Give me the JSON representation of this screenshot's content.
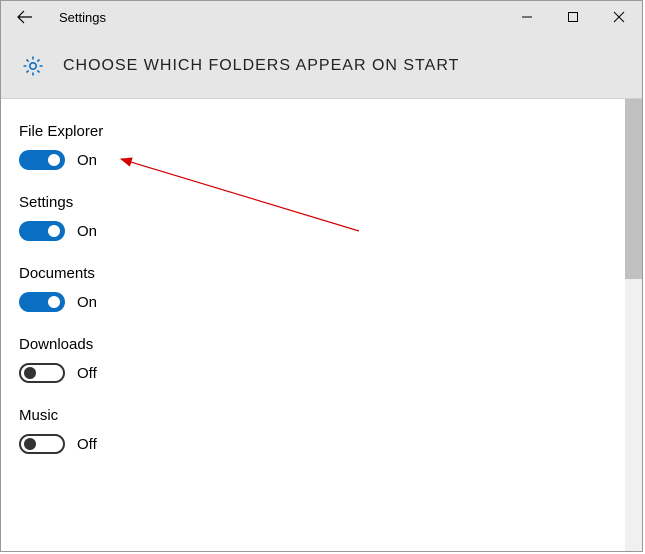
{
  "titlebar": {
    "title": "Settings"
  },
  "header": {
    "page_title": "CHOOSE WHICH FOLDERS APPEAR ON START"
  },
  "state_labels": {
    "on": "On",
    "off": "Off"
  },
  "settings": [
    {
      "label": "File Explorer",
      "on": true
    },
    {
      "label": "Settings",
      "on": true
    },
    {
      "label": "Documents",
      "on": true
    },
    {
      "label": "Downloads",
      "on": false
    },
    {
      "label": "Music",
      "on": false
    }
  ],
  "colors": {
    "accent": "#0a6fc2",
    "header_bg": "#e6e6e6"
  }
}
